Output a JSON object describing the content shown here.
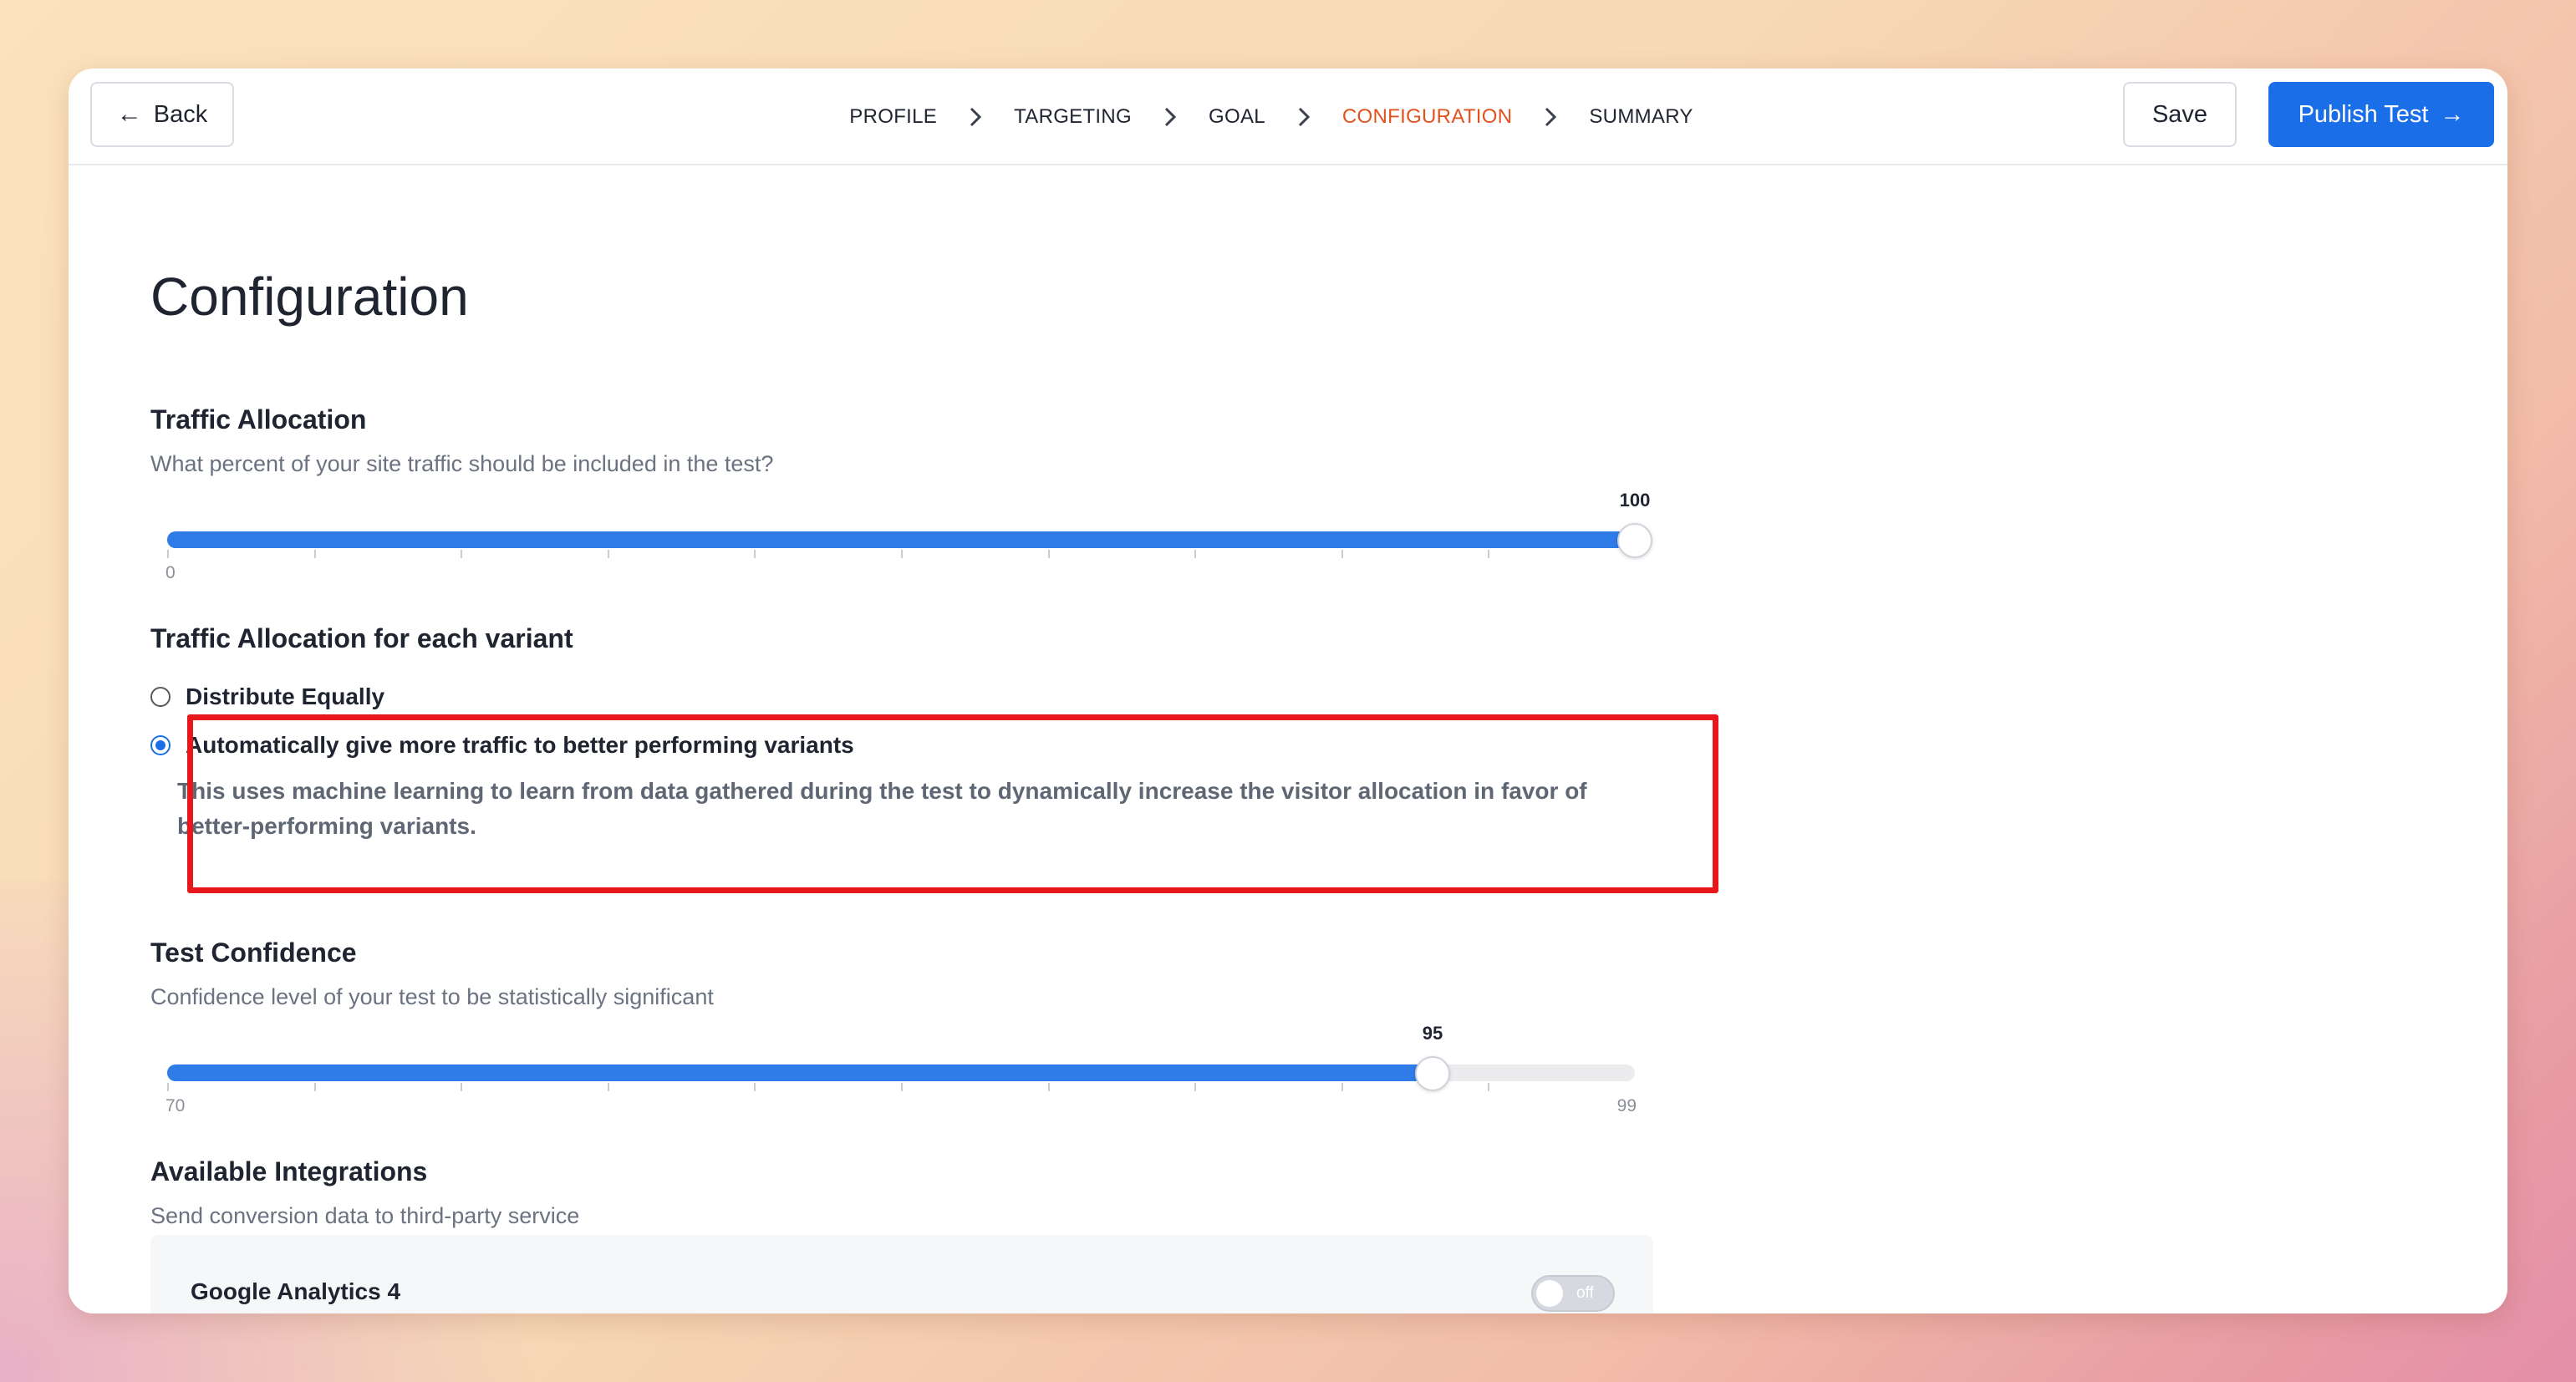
{
  "header": {
    "back_label": "Back",
    "save_label": "Save",
    "publish_label": "Publish Test",
    "steps": [
      "PROFILE",
      "TARGETING",
      "GOAL",
      "CONFIGURATION",
      "SUMMARY"
    ],
    "active_step": "CONFIGURATION",
    "accent_color": "#e2521e",
    "primary_color": "#1a6fe8"
  },
  "page": {
    "title": "Configuration"
  },
  "traffic_allocation": {
    "title": "Traffic Allocation",
    "description": "What percent of your site traffic should be included in the test?",
    "slider": {
      "min": 0,
      "max": 100,
      "value": 100,
      "min_label": "0",
      "value_label": "100"
    }
  },
  "variant_allocation": {
    "title": "Traffic Allocation for each variant",
    "options": [
      {
        "label": "Distribute Equally",
        "checked": false
      },
      {
        "label": "Automatically give more traffic to better performing variants",
        "checked": true,
        "help": "This uses machine learning to learn from data gathered during the test to dynamically increase the visitor allocation in favor of better-performing variants."
      }
    ]
  },
  "test_confidence": {
    "title": "Test Confidence",
    "description": "Confidence level of your test to be statistically significant",
    "slider": {
      "min": 70,
      "max": 99,
      "value": 95,
      "min_label": "70",
      "max_label": "99",
      "value_label": "95"
    }
  },
  "integrations": {
    "title": "Available Integrations",
    "description": "Send conversion data to third-party service",
    "items": [
      {
        "name": "Google Analytics 4",
        "enabled": false,
        "state_label": "off"
      }
    ]
  }
}
